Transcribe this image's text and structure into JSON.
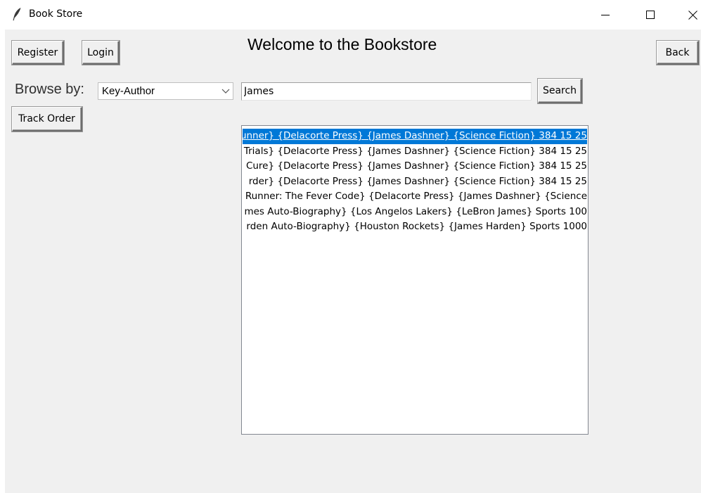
{
  "window": {
    "title": "Book Store",
    "icon": "feather-icon",
    "controls": [
      "minimize-icon",
      "maximize-icon",
      "close-icon"
    ]
  },
  "toolbar": {
    "register_label": "Register",
    "login_label": "Login",
    "back_label": "Back",
    "track_order_label": "Track Order"
  },
  "heading": "Welcome to the Bookstore",
  "browse": {
    "label": "Browse by:",
    "selected_option": "Key-Author",
    "search_value": "James",
    "search_label": "Search"
  },
  "results": {
    "selected_index": 0,
    "items": [
      "Runner} {Delacorte Press} {James Dashner} {Science Fiction} 384 15 25",
      "n Trials} {Delacorte Press} {James Dashner} {Science Fiction} 384 15 25",
      " Cure} {Delacorte Press} {James Dashner} {Science Fiction} 384 15 25",
      "rder} {Delacorte Press} {James Dashner} {Science Fiction} 384 15 25",
      "Runner: The Fever Code} {Delacorte Press} {James Dashner} {Science",
      "mes Auto-Biography} {Los Angelos Lakers} {LeBron James} Sports 100",
      "rden Auto-Biography} {Houston Rockets} {James Harden} Sports 1000"
    ]
  },
  "colors": {
    "client_bg": "#f0f0f0",
    "selection": "#0078d7"
  }
}
